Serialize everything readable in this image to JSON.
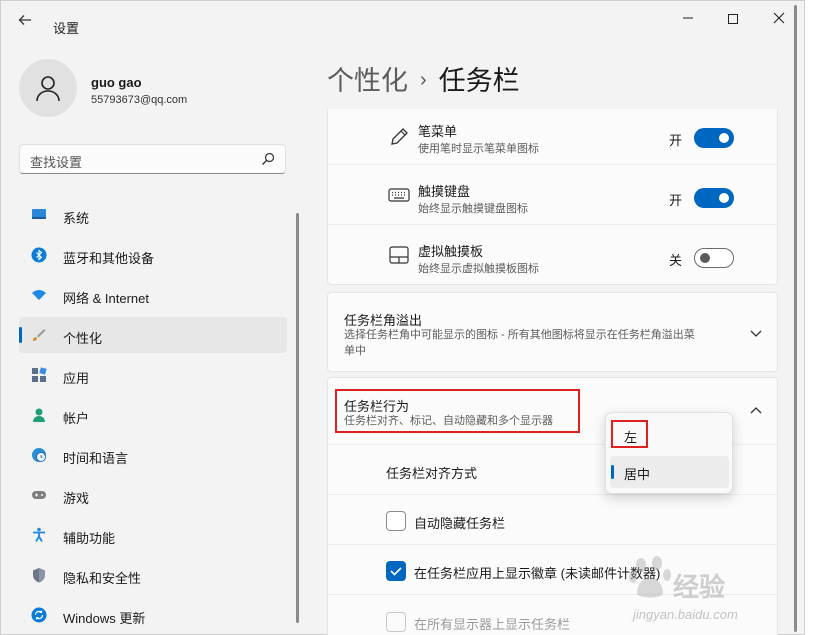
{
  "app": {
    "title": "设置"
  },
  "user": {
    "name": "guo gao",
    "email": "55793673@qq.com"
  },
  "search": {
    "placeholder": "查找设置"
  },
  "nav": [
    {
      "label": "系统",
      "icon": "monitor-icon"
    },
    {
      "label": "蓝牙和其他设备",
      "icon": "bluetooth-icon"
    },
    {
      "label": "网络 & Internet",
      "icon": "wifi-icon"
    },
    {
      "label": "个性化",
      "icon": "brush-icon",
      "selected": true
    },
    {
      "label": "应用",
      "icon": "apps-icon"
    },
    {
      "label": "帐户",
      "icon": "person-icon"
    },
    {
      "label": "时间和语言",
      "icon": "globe-clock-icon"
    },
    {
      "label": "游戏",
      "icon": "gamepad-icon"
    },
    {
      "label": "辅助功能",
      "icon": "accessibility-icon"
    },
    {
      "label": "隐私和安全性",
      "icon": "shield-icon"
    },
    {
      "label": "Windows 更新",
      "icon": "update-icon"
    }
  ],
  "breadcrumb": {
    "parent": "个性化",
    "separator": "›",
    "current": "任务栏"
  },
  "pen_menu": {
    "title": "笔菜单",
    "sub": "使用笔时显示笔菜单图标",
    "state": "开",
    "on": true
  },
  "touch_keyboard": {
    "title": "触摸键盘",
    "sub": "始终显示触摸键盘图标",
    "state": "开",
    "on": true
  },
  "virtual_touchpad": {
    "title": "虚拟触摸板",
    "sub": "始终显示虚拟触摸板图标",
    "state": "关",
    "on": false
  },
  "overflow": {
    "title": "任务栏角溢出",
    "sub_line1": "选择任务栏角中可能显示的图标 - 所有其他图标将显示在任务栏角溢出菜",
    "sub_line2": "单中"
  },
  "behaviors": {
    "title": "任务栏行为",
    "sub": "任务栏对齐、标记、自动隐藏和多个显示器",
    "alignment_label": "任务栏对齐方式",
    "alignment_options": [
      "左",
      "居中"
    ],
    "alignment_selected": "居中",
    "auto_hide": "自动隐藏任务栏",
    "badges": "在任务栏应用上显示徽章 (未读邮件计数器)",
    "all_displays": "在所有显示器上显示任务栏"
  },
  "colors": {
    "accent": "#0067c0",
    "highlight": "#e02020"
  },
  "watermark": {
    "text": "经验",
    "url": "jingyan.baidu.com"
  }
}
